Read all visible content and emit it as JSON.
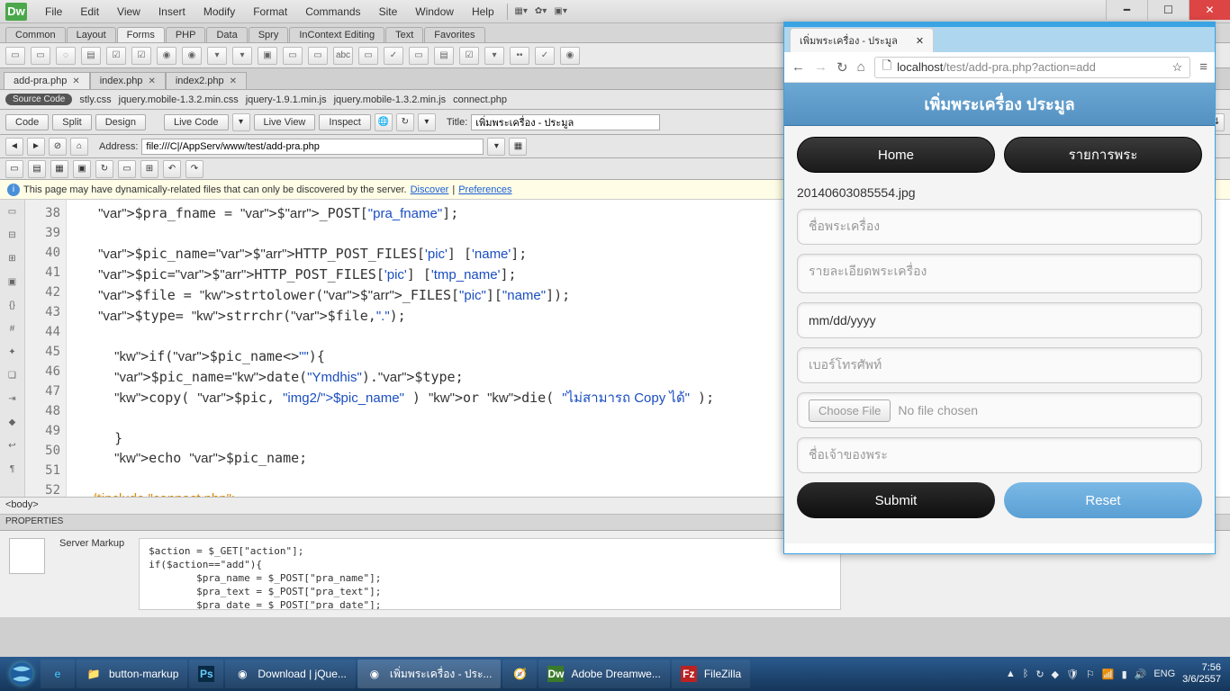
{
  "menubar": {
    "logo": "Dw",
    "items": [
      "File",
      "Edit",
      "View",
      "Insert",
      "Modify",
      "Format",
      "Commands",
      "Site",
      "Window",
      "Help"
    ]
  },
  "insert_tabs": [
    "Common",
    "Layout",
    "Forms",
    "PHP",
    "Data",
    "Spry",
    "InContext Editing",
    "Text",
    "Favorites"
  ],
  "insert_active": "Forms",
  "doc_tabs": [
    {
      "label": "add-pra.php",
      "active": true
    },
    {
      "label": "index.php",
      "active": false
    },
    {
      "label": "index2.php",
      "active": false
    }
  ],
  "related": {
    "badge": "Source Code",
    "files": [
      "stly.css",
      "jquery.mobile-1.3.2.min.css",
      "jquery-1.9.1.min.js",
      "jquery.mobile-1.3.2.min.js",
      "connect.php"
    ]
  },
  "viewbar": {
    "code": "Code",
    "split": "Split",
    "design": "Design",
    "livecode": "Live Code",
    "liveview": "Live View",
    "inspect": "Inspect",
    "title_label": "Title:",
    "title_value": "เพิ่มพระเครื่อง - ประมูล"
  },
  "address": {
    "label": "Address:",
    "value": "file:///C|/AppServ/www/test/add-pra.php"
  },
  "notice": {
    "text": "This page may have dynamically-related files that can only be discovered by the server.",
    "discover": "Discover",
    "preferences": "Preferences"
  },
  "code": {
    "start": 38,
    "lines": [
      "   $pra_fname = $_POST[\"pra_fname\"];",
      "",
      "   $pic_name=$HTTP_POST_FILES['pic'] ['name'];",
      "   $pic=$HTTP_POST_FILES['pic'] ['tmp_name'];",
      "   $file = strtolower($_FILES[\"pic\"][\"name\"]);",
      "   $type= strrchr($file,\".\");",
      "",
      "     if($pic_name<>\"\"){",
      "     $pic_name=date(\"Ymdhis\").$type;",
      "     copy( $pic, \"img2/$pic_name\" ) or die( \"ไม่สามารถ Copy ได้\" );",
      "",
      "     }",
      "     echo $pic_name;",
      "",
      "     /*include \"connect.php\";"
    ]
  },
  "pathbar": "<body>",
  "properties": {
    "header": "PROPERTIES",
    "label": "Server Markup",
    "lines": [
      "$action = $_GET[\"action\"];",
      "if($action==\"add\"){",
      "        $pra_name = $_POST[\"pra_name\"];",
      "        $pra_text = $_POST[\"pra_text\"];",
      "        $pra_date = $_POST[\"pra_date\"];"
    ]
  },
  "browser": {
    "tab": "เพิ่มพระเครื่อง - ประมูล",
    "host": "localhost",
    "path": "/test/add-pra.php?action=add",
    "page_title": "เพิ่มพระเครื่อง ประมูล",
    "btn_home": "Home",
    "btn_list": "รายการพระ",
    "filename_text": "20140603085554.jpg",
    "ph_name": "ชื่อพระเครื่อง",
    "ph_detail": "รายละเอียดพระเครื่อง",
    "ph_date": "mm/dd/yyyy",
    "ph_phone": "เบอร์โทรศัพท์",
    "choose": "Choose File",
    "nofile": "No file chosen",
    "ph_owner": "ชื่อเจ้าของพระ",
    "submit": "Submit",
    "reset": "Reset"
  },
  "taskbar": {
    "items": [
      "button-markup",
      "",
      "Download | jQue...",
      "เพิ่มพระเครื่อง - ประ...",
      "",
      "Adobe Dreamwe...",
      "FileZilla"
    ],
    "lang": "ENG",
    "time": "7:56",
    "date": "3/6/2557"
  }
}
